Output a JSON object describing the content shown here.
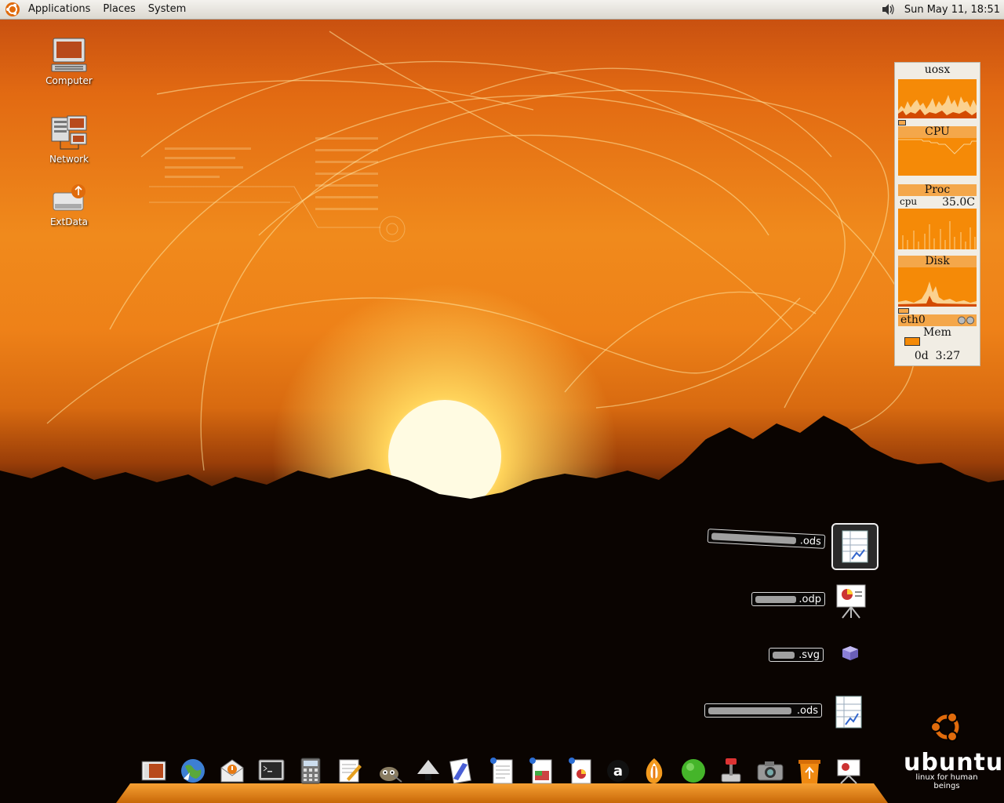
{
  "top_panel": {
    "menus": [
      "Applications",
      "Places",
      "System"
    ],
    "volume_icon": "speaker-icon",
    "clock": "Sun May 11, 18:51"
  },
  "desktop_icons": [
    {
      "label": "Computer",
      "icon": "computer-icon"
    },
    {
      "label": "Network",
      "icon": "network-icon"
    },
    {
      "label": "ExtData",
      "icon": "drive-icon"
    }
  ],
  "system_monitor": {
    "host": "uosx",
    "cpu_label": "CPU",
    "proc_label": "Proc",
    "cpu_small": "cpu",
    "cpu_temp": "35.0C",
    "disk_label": "Disk",
    "net_label": "eth0",
    "mem_label": "Mem",
    "uptime": "0d  3:27"
  },
  "recent_files": [
    {
      "ext": ".ods",
      "icon": "spreadsheet-icon"
    },
    {
      "ext": ".odp",
      "icon": "presentation-icon"
    },
    {
      "ext": ".svg",
      "icon": "drawing-icon"
    },
    {
      "ext": ".ods",
      "icon": "spreadsheet-icon"
    }
  ],
  "dock_items": [
    "desktop-icon",
    "browser-icon",
    "mail-icon",
    "terminal-icon",
    "calculator-icon",
    "text-editor-icon",
    "gimp-icon",
    "inkscape-icon",
    "draw-icon",
    "writer-icon",
    "impress-icon",
    "presentation-icon",
    "amarok-icon",
    "vlc-icon",
    "green-status-icon",
    "joystick-icon",
    "camera-icon",
    "trash-icon",
    "projector-icon"
  ],
  "brand": {
    "name": "ubuntu",
    "tagline": "linux for human beings"
  },
  "colors": {
    "accent_orange": "#f58a07",
    "panel_bg": "#e8e5df",
    "monitor_band": "#f4a74a"
  }
}
